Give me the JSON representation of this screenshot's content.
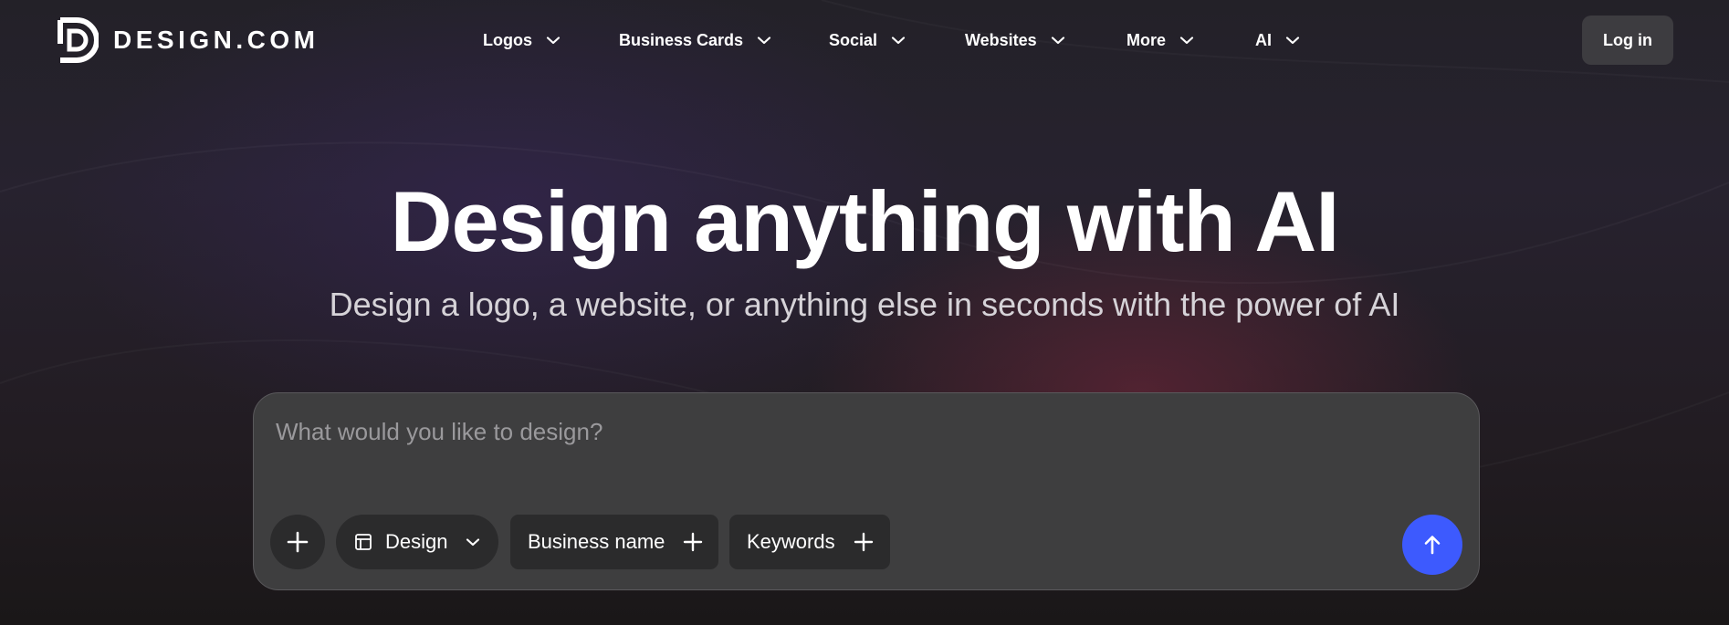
{
  "brand": {
    "name": "DESIGN.COM"
  },
  "nav": {
    "items": [
      {
        "label": "Logos"
      },
      {
        "label": "Business Cards"
      },
      {
        "label": "Social"
      },
      {
        "label": "Websites"
      },
      {
        "label": "More"
      },
      {
        "label": "AI"
      }
    ],
    "login_label": "Log in"
  },
  "hero": {
    "title": "Design anything with AI",
    "subtitle": "Design a logo, a website, or anything else in seconds with the power of AI"
  },
  "prompt": {
    "placeholder": "What would you like to design?",
    "design_select": {
      "label": "Design",
      "icon": "layout-icon"
    },
    "business_chip": {
      "label": "Business name",
      "icon": "plus-icon"
    },
    "keywords_chip": {
      "label": "Keywords",
      "icon": "plus-icon"
    },
    "submit_icon": "arrow-up-icon"
  },
  "colors": {
    "submit_accent": "#3d5afe",
    "login_bg": "#3d3c40",
    "prompt_bg": "#3e3e3f",
    "chip_bg": "#2b2b2c"
  }
}
